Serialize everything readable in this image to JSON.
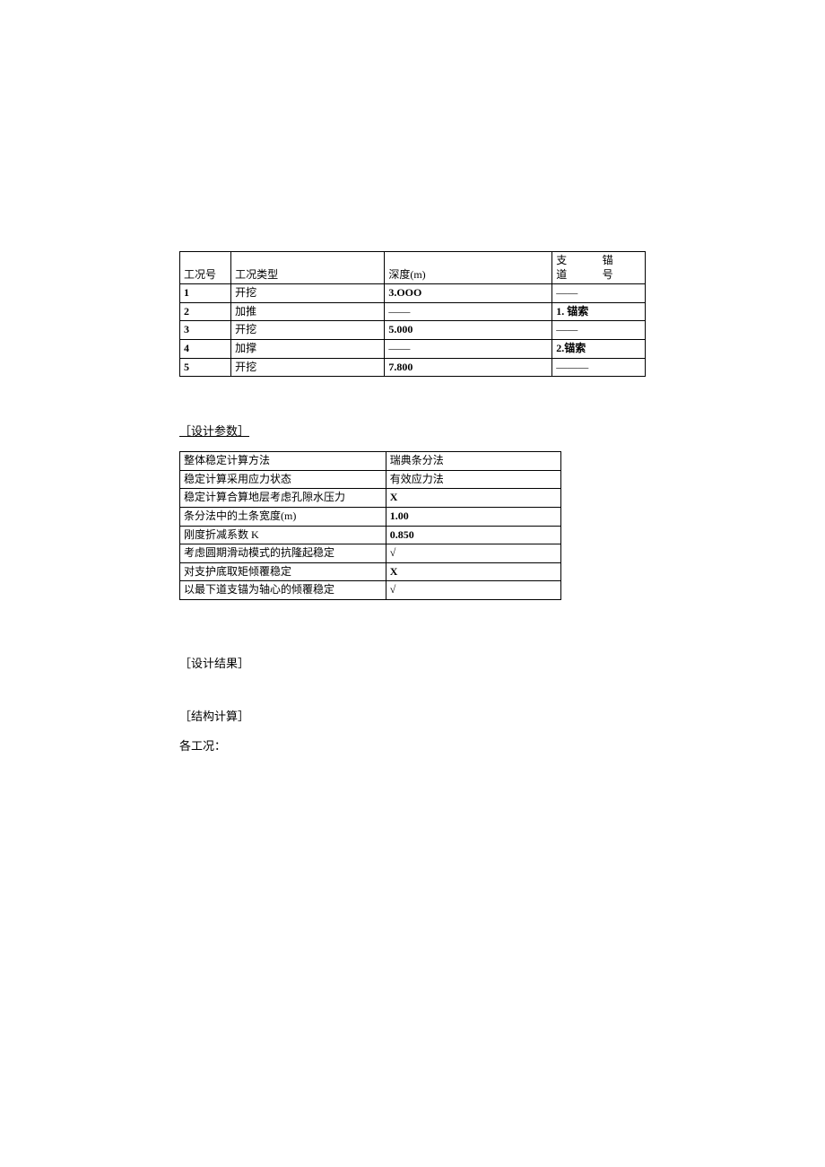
{
  "table1": {
    "headers": {
      "c1": "工况号",
      "c2": "工况类型",
      "c3": "深度(m)",
      "c4a": "支\n道",
      "c4b": "锚\n号"
    },
    "rows": [
      {
        "c1": "1",
        "c2": "开挖",
        "c3": "3.OOO",
        "c4": "——"
      },
      {
        "c1": "2",
        "c2": "加推",
        "c3": "——",
        "c4": "1. 锚索"
      },
      {
        "c1": "3",
        "c2": "开挖",
        "c3": "5.000",
        "c4": "——"
      },
      {
        "c1": "4",
        "c2": "加撑",
        "c3": "——",
        "c4": "2.锚索"
      },
      {
        "c1": "5",
        "c2": "开挖",
        "c3": "7.800",
        "c4": "———"
      }
    ]
  },
  "headings": {
    "h1": "［设计参数］",
    "h2": "［设计结果］",
    "h3": "［结构计算］"
  },
  "table2": {
    "rows": [
      {
        "a": "整体稳定计算方法",
        "b": "瑞典条分法"
      },
      {
        "a": "稳定计算采用应力状态",
        "b": "有效应力法"
      },
      {
        "a": "稳定计算合算地层考虑孔隙水压力",
        "b": "X",
        "bBold": true
      },
      {
        "a": "条分法中的土条宽度(m)",
        "b": "1.00",
        "bBold": true
      },
      {
        "a": "刚度折减系数 K",
        "b": "0.850",
        "bBold": true
      },
      {
        "a": "考虑圆期滑动模式的抗隆起稳定",
        "b": "√"
      },
      {
        "a": "对支护底取矩倾覆稳定",
        "b": "X",
        "bBold": true
      },
      {
        "a": "以最下道支锚为轴心的倾覆稳定",
        "b": "√"
      }
    ]
  },
  "body": {
    "line1": "各工况："
  }
}
